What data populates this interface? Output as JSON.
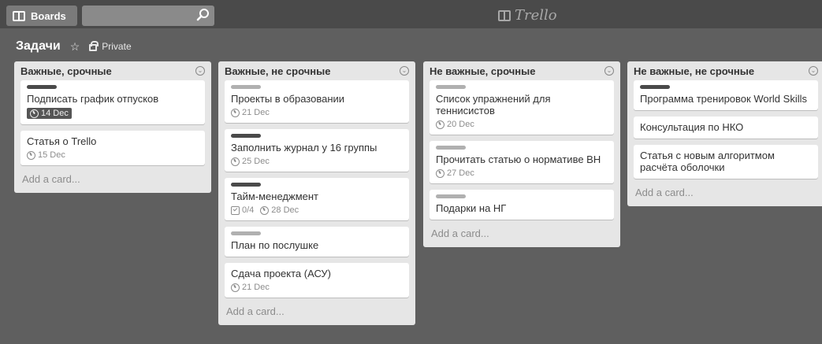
{
  "header": {
    "boards_label": "Boards",
    "logo_text": "Trello"
  },
  "board": {
    "title": "Задачи",
    "visibility": "Private"
  },
  "colors": {
    "label_dark": "#4a4a4a",
    "label_light": "#b0b0b0"
  },
  "lists": [
    {
      "title": "Важные, срочные",
      "add_card": "Add a card...",
      "cards": [
        {
          "title": "Подписать график отпусков",
          "label": "dark",
          "due": "14 Dec"
        },
        {
          "title": "Статья о Trello",
          "due": "15 Dec"
        }
      ]
    },
    {
      "title": "Важные, не срочные",
      "add_card": "Add a card...",
      "cards": [
        {
          "title": "Проекты в образовании",
          "label": "light",
          "due": "21 Dec"
        },
        {
          "title": "Заполнить журнал у 16 группы",
          "label": "dark",
          "due": "25 Dec"
        },
        {
          "title": "Тайм-менеджмент",
          "label": "dark",
          "checklist": "0/4",
          "due": "28 Dec"
        },
        {
          "title": "План по послушке",
          "label": "light"
        },
        {
          "title": "Сдача проекта (АСУ)",
          "due": "21 Dec"
        }
      ]
    },
    {
      "title": "Не важные, срочные",
      "add_card": "Add a card...",
      "cards": [
        {
          "title": "Список упражнений для теннисистов",
          "label": "light",
          "due": "20 Dec"
        },
        {
          "title": "Прочитать статью о нормативе ВН",
          "label": "light",
          "due": "27 Dec"
        },
        {
          "title": "Подарки на НГ",
          "label": "light"
        }
      ]
    },
    {
      "title": "Не важные, не срочные",
      "add_card": "Add a card...",
      "cards": [
        {
          "title": "Программа тренировок World Skills",
          "label": "dark"
        },
        {
          "title": "Консультация по НКО"
        },
        {
          "title": "Статья с новым алгоритмом расчёта оболочки"
        }
      ]
    }
  ]
}
